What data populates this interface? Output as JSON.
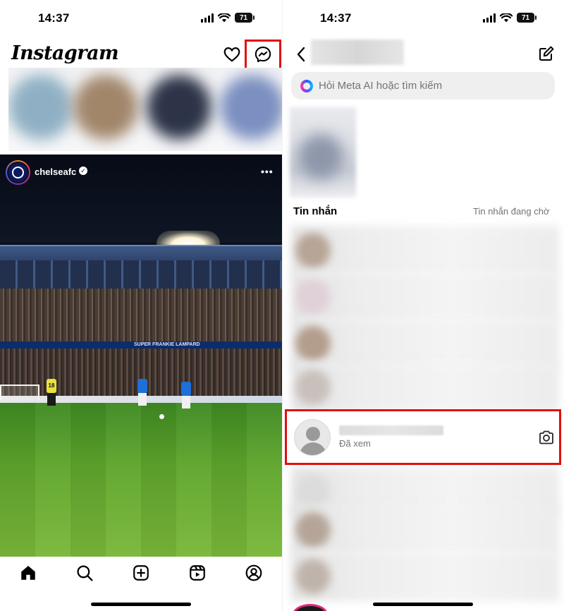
{
  "left_panel": {
    "status_bar": {
      "time": "14:37",
      "battery": "71"
    },
    "header": {
      "logo": "Instagram",
      "icons": [
        "heart-icon",
        "messenger-icon"
      ],
      "highlighted_icon": "messenger-icon"
    },
    "post": {
      "username": "chelseafc",
      "verified_mark": "✓",
      "more_label": "•••",
      "banner_text": "SUPER FRANKIE LAMPARD",
      "player_number": "18"
    },
    "bottom_nav": [
      "home-icon",
      "search-icon",
      "create-icon",
      "reels-icon",
      "profile-icon"
    ]
  },
  "right_panel": {
    "status_bar": {
      "time": "14:37",
      "battery": "71"
    },
    "header": {
      "icons": [
        "back-icon",
        "edit-icon"
      ]
    },
    "search": {
      "placeholder": "Hỏi Meta AI hoặc tìm kiếm"
    },
    "section": {
      "messages_label": "Tin nhắn",
      "requests_label": "Tin nhắn đang chờ"
    },
    "highlighted_thread": {
      "status": "Đã xem",
      "action_icon": "camera-icon"
    }
  },
  "colors": {
    "highlight": "#e10e0e",
    "text_secondary": "#737373",
    "search_bg": "#efefef"
  }
}
